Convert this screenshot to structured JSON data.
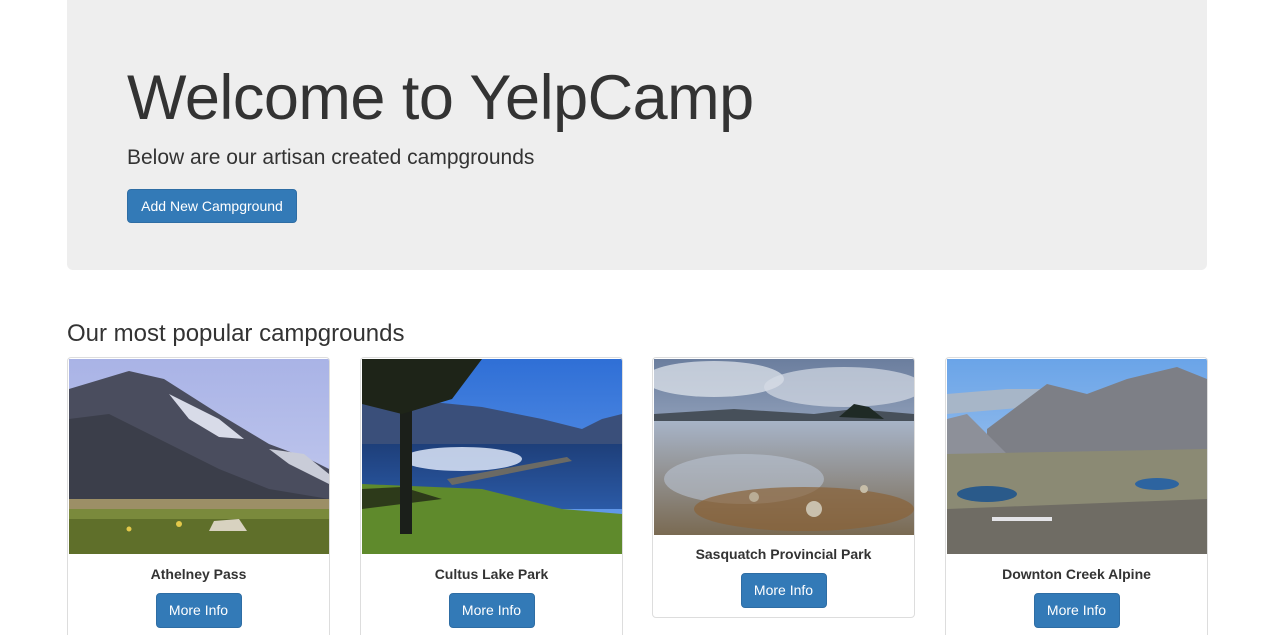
{
  "jumbotron": {
    "title": "Welcome to YelpCamp",
    "subtitle": "Below are our artisan created campgrounds",
    "add_button_label": "Add New Campground"
  },
  "section": {
    "heading": "Our most popular campgrounds"
  },
  "campgrounds": [
    {
      "name": "Athelney Pass",
      "button_label": "More Info"
    },
    {
      "name": "Cultus Lake Park",
      "button_label": "More Info"
    },
    {
      "name": "Sasquatch Provincial Park",
      "button_label": "More Info"
    },
    {
      "name": "Downton Creek Alpine",
      "button_label": "More Info"
    }
  ],
  "colors": {
    "primary": "#337ab7",
    "jumbotron_bg": "#eeeeee",
    "text": "#333333"
  }
}
